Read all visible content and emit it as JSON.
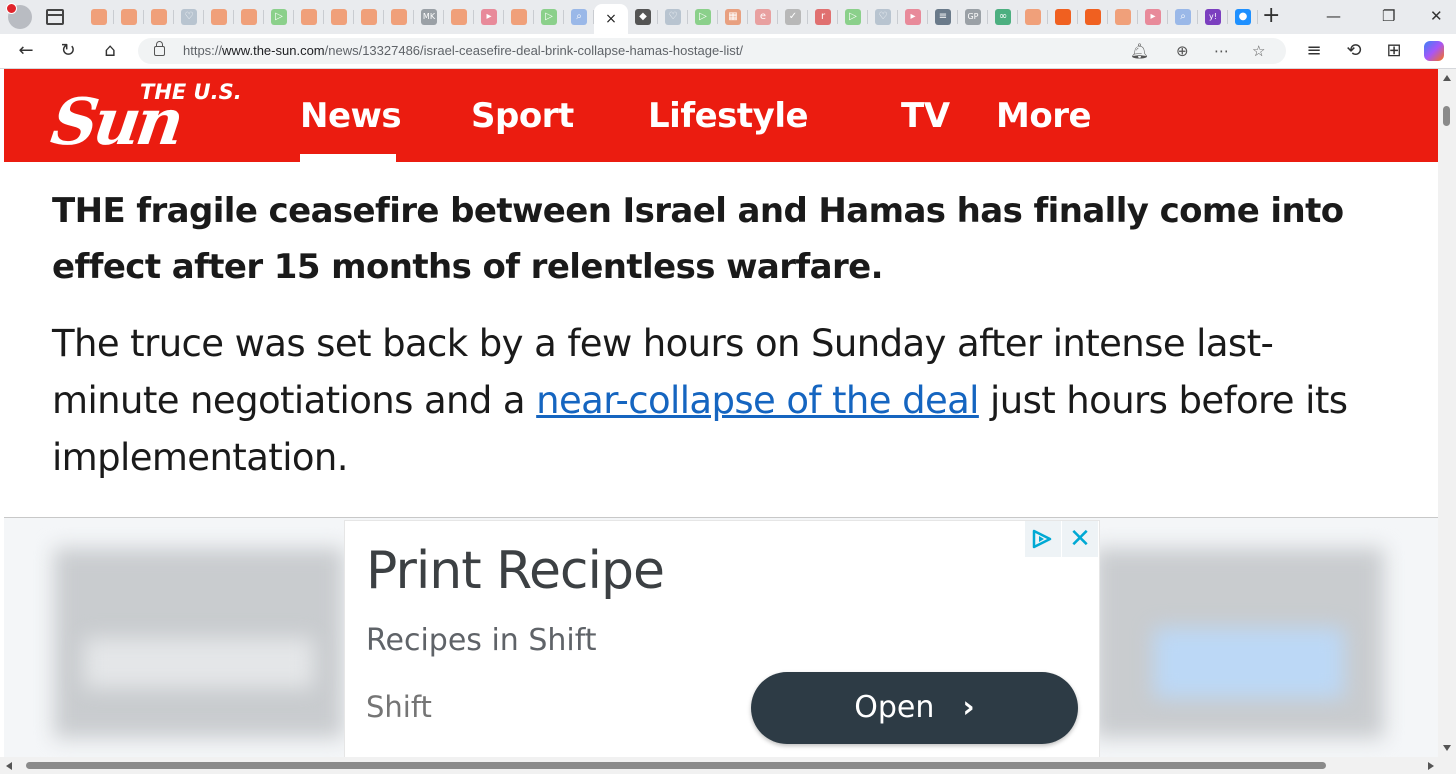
{
  "browser": {
    "url_prefix": "https://",
    "url_domain": "www.the-sun.com",
    "url_path": "/news/13327486/israel-ceasefire-deal-brink-collapse-hamas-hostage-list/",
    "active_tab_close": "×",
    "new_tab": "+",
    "tab_favicons": [
      {
        "icon": "bookmark-icon",
        "color": "#f0a07a",
        "glyph": ""
      },
      {
        "icon": "bookmark-icon",
        "color": "#f0a07a",
        "glyph": ""
      },
      {
        "icon": "bookmark-icon",
        "color": "#f0a07a",
        "glyph": ""
      },
      {
        "icon": "heart-rate-icon",
        "color": "#b8c4d0",
        "glyph": "♡"
      },
      {
        "icon": "bookmark-icon",
        "color": "#f0a07a",
        "glyph": ""
      },
      {
        "icon": "bookmark-icon",
        "color": "#f0a07a",
        "glyph": ""
      },
      {
        "icon": "play-icon",
        "color": "#8bd08b",
        "glyph": "▷"
      },
      {
        "icon": "bookmark-icon",
        "color": "#f0a07a",
        "glyph": ""
      },
      {
        "icon": "bookmark-icon",
        "color": "#f0a07a",
        "glyph": ""
      },
      {
        "icon": "bookmark-icon",
        "color": "#f0a07a",
        "glyph": ""
      },
      {
        "icon": "bookmark-icon",
        "color": "#f0a07a",
        "glyph": ""
      },
      {
        "icon": "mk-icon",
        "color": "#9aa0a6",
        "glyph": "MK"
      },
      {
        "icon": "bookmark-icon",
        "color": "#f0a07a",
        "glyph": ""
      },
      {
        "icon": "youtube-icon",
        "color": "#e88a9a",
        "glyph": "▸"
      },
      {
        "icon": "bookmark-icon",
        "color": "#f0a07a",
        "glyph": ""
      },
      {
        "icon": "play-icon",
        "color": "#8bd08b",
        "glyph": "▷"
      },
      {
        "icon": "search-icon",
        "color": "#9ab8e8",
        "glyph": "⌕"
      },
      {
        "icon": "active",
        "color": "#ffffff",
        "glyph": ""
      },
      {
        "icon": "diamond-icon",
        "color": "#555555",
        "glyph": "◆"
      },
      {
        "icon": "heart-rate-icon",
        "color": "#b8c4d0",
        "glyph": "♡"
      },
      {
        "icon": "play-icon",
        "color": "#8bd08b",
        "glyph": "▷"
      },
      {
        "icon": "grid-icon",
        "color": "#e8a080",
        "glyph": "▦"
      },
      {
        "icon": "e-icon",
        "color": "#e8a0a0",
        "glyph": "e"
      },
      {
        "icon": "bird-icon",
        "color": "#b8b8b8",
        "glyph": "✓"
      },
      {
        "icon": "r-icon",
        "color": "#e07070",
        "glyph": "r"
      },
      {
        "icon": "play-icon",
        "color": "#8bd08b",
        "glyph": "▷"
      },
      {
        "icon": "heart-rate-icon",
        "color": "#b8c4d0",
        "glyph": "♡"
      },
      {
        "icon": "youtube-icon",
        "color": "#e88a9a",
        "glyph": "▸"
      },
      {
        "icon": "news-icon",
        "color": "#6a7a8a",
        "glyph": "≡"
      },
      {
        "icon": "gp-icon",
        "color": "#9aa0a6",
        "glyph": "GP"
      },
      {
        "icon": "owl-icon",
        "color": "#4caf80",
        "glyph": "∞"
      },
      {
        "icon": "bookmark-icon",
        "color": "#f0a07a",
        "glyph": ""
      },
      {
        "icon": "bookmark-icon",
        "color": "#f06020",
        "glyph": ""
      },
      {
        "icon": "bookmark-icon",
        "color": "#f06020",
        "glyph": ""
      },
      {
        "icon": "bookmark-icon",
        "color": "#f0a07a",
        "glyph": ""
      },
      {
        "icon": "youtube-icon",
        "color": "#e88a9a",
        "glyph": "▸"
      },
      {
        "icon": "search-icon",
        "color": "#9ab8e8",
        "glyph": "⌕"
      },
      {
        "icon": "yahoo-icon",
        "color": "#7b3fbf",
        "glyph": "y!"
      },
      {
        "icon": "news-icon",
        "color": "#1e90ff",
        "glyph": "●"
      }
    ]
  },
  "site": {
    "logo_small": "THE U.S.",
    "logo_word": "Sun",
    "brand_color": "#eb1c10",
    "nav": [
      {
        "label": "News",
        "active": true
      },
      {
        "label": "Sport"
      },
      {
        "label": "Lifestyle"
      },
      {
        "label": "TV"
      },
      {
        "label": "More"
      }
    ]
  },
  "article": {
    "lead": "THE fragile ceasefire between Israel and Hamas has finally come into effect after 15 months of relentless warfare.",
    "para_before": "The truce was set back by a few hours on Sunday after intense last-minute negotiations and a ",
    "para_link": "near-collapse of the deal",
    "para_after": " just hours before its implementation.",
    "link_color": "#1565c0"
  },
  "ad": {
    "title": "Print Recipe",
    "subtitle": "Recipes in Shift",
    "advertiser": "Shift",
    "cta": "Open",
    "cta_chevron": "›",
    "close": "✕",
    "button_color": "#2d3b45",
    "accent": "#00a9d4"
  }
}
